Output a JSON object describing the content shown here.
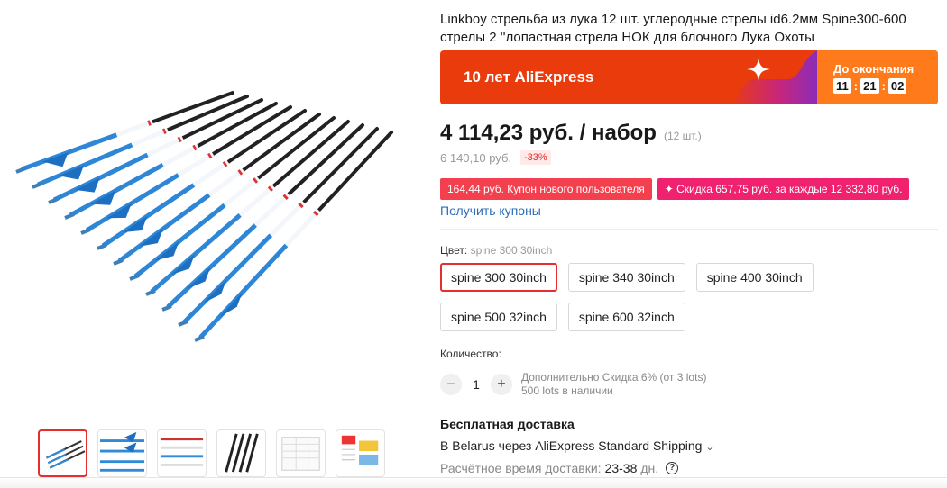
{
  "product": {
    "title": "Linkboy стрельба из лука 12 шт. углеродные стрелы id6.2мм Spine300-600 стрелы 2 ''лопастная стрела НОК для блочного Лука Охоты"
  },
  "gallery": {
    "main_image_alt": "arrows",
    "thumbnail_icons": [
      "arrows-image-icon",
      "arrows-image-icon",
      "arrows-image-icon",
      "arrows-image-icon",
      "spec-table-image-icon",
      "spec-sheet-image-icon"
    ]
  },
  "promo": {
    "label": "10 лет AliExpress",
    "countdown_label": "До окончания",
    "hours": "11",
    "minutes": "21",
    "seconds": "02",
    "sep": ":",
    "colors": {
      "banner": "#ea3b0d",
      "countdown": "#ff7a1a"
    }
  },
  "price": {
    "current": "4 114,23 руб. / набор",
    "unit": "(12 шт.)",
    "old": "6 140,10 руб.",
    "discount": "-33%"
  },
  "coupons": {
    "new_user": "164,44 руб. Купон нового пользователя",
    "spend": "✦ Скидка 657,75 руб. за каждые 12 332,80 руб.",
    "get_link": "Получить купоны"
  },
  "variants": {
    "label": "Цвет:",
    "selected_value": "spine 300 30inch",
    "options": [
      "spine 300 30inch",
      "spine 340 30inch",
      "spine 400 30inch",
      "spine 500 32inch",
      "spine 600 32inch"
    ]
  },
  "quantity": {
    "label": "Количество:",
    "minus": "−",
    "value": "1",
    "plus": "+",
    "extra_discount": "Дополнительно Скидка 6% (от 3 lots)",
    "stock": "500 lots в наличии"
  },
  "shipping": {
    "title": "Бесплатная доставка",
    "line": "В Belarus через AliExpress Standard Shipping",
    "eta_label": "Расчётное время доставки:",
    "eta_days": "23-38",
    "eta_unit": "дн."
  }
}
